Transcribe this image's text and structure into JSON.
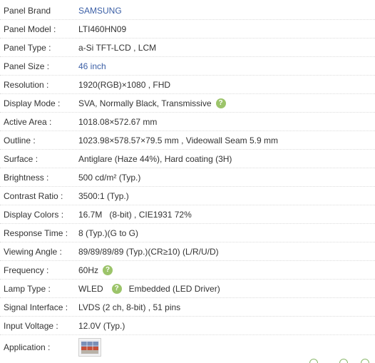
{
  "specs": [
    {
      "label": "Panel Brand",
      "value": "SAMSUNG",
      "link": true
    },
    {
      "label": "Panel Model :",
      "value": "LTI460HN09",
      "link": false
    },
    {
      "label": "Panel Type :",
      "value": "a-Si TFT-LCD , LCM",
      "link": false
    },
    {
      "label": "Panel Size :",
      "value": "46 inch",
      "link": true
    },
    {
      "label": "Resolution :",
      "value": "1920(RGB)×1080 , FHD",
      "link": false
    },
    {
      "label": "Display Mode :",
      "value": "SVA, Normally Black, Transmissive",
      "link": false
    },
    {
      "label": "Active Area :",
      "value": "1018.08×572.67 mm",
      "link": false
    },
    {
      "label": "Outline :",
      "value": "1023.98×578.57×79.5 mm , Videowall Seam 5.9 mm",
      "link": false
    },
    {
      "label": "Surface :",
      "value": "Antiglare (Haze 44%), Hard coating (3H)",
      "link": false
    },
    {
      "label": "Brightness :",
      "value": "500 cd/m² (Typ.)",
      "link": false
    },
    {
      "label": "Contrast Ratio :",
      "value": "3500:1 (Typ.)",
      "link": false
    },
    {
      "label": "Display Colors :",
      "value": "16.7M   (8-bit) , CIE1931 72%",
      "link": false
    },
    {
      "label": "Response Time :",
      "value": "8 (Typ.)(G to G)",
      "link": false
    },
    {
      "label": "Viewing Angle :",
      "value": "89/89/89/89 (Typ.)(CR≥10) (L/R/U/D)",
      "link": false
    },
    {
      "label": "Frequency :",
      "value": "60Hz",
      "link": false
    },
    {
      "label": "Lamp Type :",
      "value": "WLED",
      "value2": "Embedded (LED Driver)",
      "link": false
    },
    {
      "label": "Signal Interface :",
      "value": "LVDS (2 ch, 8-bit) , 51 pins",
      "link": false
    },
    {
      "label": "Input Voltage :",
      "value": "12.0V (Typ.)",
      "link": false
    },
    {
      "label": "Application :",
      "value": "",
      "link": false
    }
  ],
  "help_glyph": "?",
  "icons": {
    "help": "question-circle-icon",
    "application": "videowall-thumbnail-icon"
  },
  "colors": {
    "link": "#3b5fa6",
    "help_badge": "#9cc46a",
    "text": "#333333"
  }
}
